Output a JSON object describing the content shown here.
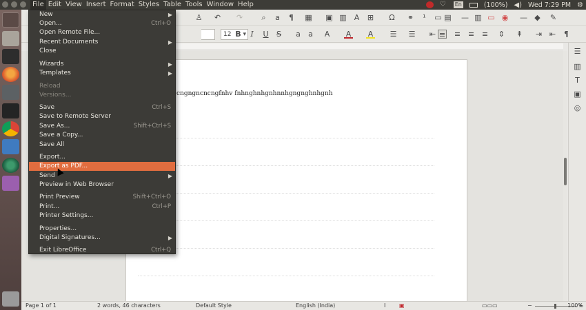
{
  "menubar": [
    "File",
    "Edit",
    "View",
    "Insert",
    "Format",
    "Styles",
    "Table",
    "Tools",
    "Window",
    "Help"
  ],
  "indicators": {
    "battery": "(100%)",
    "keyboard": "En",
    "clock": "Wed 7:29 PM"
  },
  "toolbar": {
    "font_size": "12"
  },
  "document": {
    "text": "cngngncncngfnhv fnhnghnhgnhnnhgngnghnhgnh"
  },
  "file_menu": {
    "items": [
      {
        "label": "New",
        "shortcut": "",
        "submenu": true,
        "disabled": false
      },
      {
        "label": "Open...",
        "shortcut": "Ctrl+O",
        "submenu": false,
        "disabled": false
      },
      {
        "label": "Open Remote File...",
        "shortcut": "",
        "submenu": false,
        "disabled": false
      },
      {
        "label": "Recent Documents",
        "shortcut": "",
        "submenu": true,
        "disabled": false
      },
      {
        "label": "Close",
        "shortcut": "",
        "submenu": false,
        "disabled": false
      },
      {
        "label": "Wizards",
        "shortcut": "",
        "submenu": true,
        "disabled": false
      },
      {
        "label": "Templates",
        "shortcut": "",
        "submenu": true,
        "disabled": false
      },
      {
        "label": "Reload",
        "shortcut": "",
        "submenu": false,
        "disabled": true
      },
      {
        "label": "Versions...",
        "shortcut": "",
        "submenu": false,
        "disabled": true
      },
      {
        "label": "Save",
        "shortcut": "Ctrl+S",
        "submenu": false,
        "disabled": false
      },
      {
        "label": "Save to Remote Server",
        "shortcut": "",
        "submenu": false,
        "disabled": false
      },
      {
        "label": "Save As...",
        "shortcut": "Shift+Ctrl+S",
        "submenu": false,
        "disabled": false
      },
      {
        "label": "Save a Copy...",
        "shortcut": "",
        "submenu": false,
        "disabled": false
      },
      {
        "label": "Save All",
        "shortcut": "",
        "submenu": false,
        "disabled": false
      },
      {
        "label": "Export...",
        "shortcut": "",
        "submenu": false,
        "disabled": false
      },
      {
        "label": "Export as PDF...",
        "shortcut": "",
        "submenu": false,
        "disabled": false,
        "highlighted": true
      },
      {
        "label": "Send",
        "shortcut": "",
        "submenu": true,
        "disabled": false
      },
      {
        "label": "Preview in Web Browser",
        "shortcut": "",
        "submenu": false,
        "disabled": false
      },
      {
        "label": "Print Preview",
        "shortcut": "Shift+Ctrl+O",
        "submenu": false,
        "disabled": false
      },
      {
        "label": "Print...",
        "shortcut": "Ctrl+P",
        "submenu": false,
        "disabled": false
      },
      {
        "label": "Printer Settings...",
        "shortcut": "",
        "submenu": false,
        "disabled": false
      },
      {
        "label": "Properties...",
        "shortcut": "",
        "submenu": false,
        "disabled": false
      },
      {
        "label": "Digital Signatures...",
        "shortcut": "",
        "submenu": true,
        "disabled": false
      },
      {
        "label": "Exit LibreOffice",
        "shortcut": "Ctrl+Q",
        "submenu": false,
        "disabled": false
      }
    ]
  },
  "statusbar": {
    "page": "Page 1 of 1",
    "words": "2 words, 46 characters",
    "style": "Default Style",
    "language": "English (India)",
    "zoom": "100%"
  },
  "colors": {
    "menu_bg": "#3c3b37",
    "highlight": "#e16d3f",
    "topbar": "#3d3c37"
  }
}
